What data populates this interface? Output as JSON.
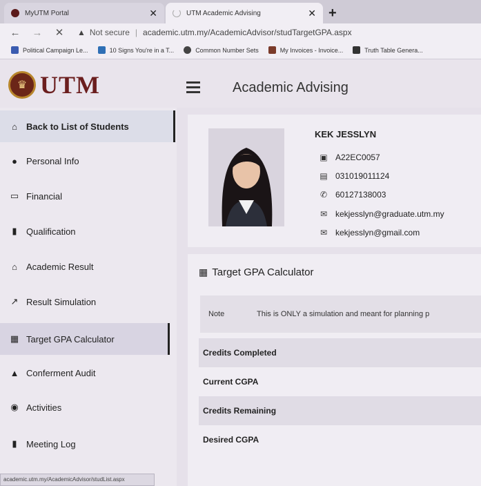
{
  "browser": {
    "tabs": [
      {
        "title": "MyUTM Portal",
        "active": false
      },
      {
        "title": "UTM Academic Advising",
        "active": true
      }
    ],
    "new_tab": "+",
    "security_label": "Not secure",
    "url": "academic.utm.my/AcademicAdvisor/studTargetGPA.aspx",
    "bookmarks": [
      "Political Campaign Le...",
      "10 Signs You're in a T...",
      "Common Number Sets",
      "My Invoices - Invoice...",
      "Truth Table Genera..."
    ],
    "status_url": "academic.utm.my/AcademicAdvisor/studList.aspx"
  },
  "header": {
    "logo_text": "UTM",
    "title": "Academic Advising"
  },
  "sidebar": {
    "items": [
      {
        "label": "Back to List of Students",
        "icon": "home-icon"
      },
      {
        "label": "Personal Info",
        "icon": "user-icon"
      },
      {
        "label": "Financial",
        "icon": "money-icon"
      },
      {
        "label": "Qualification",
        "icon": "book-icon"
      },
      {
        "label": "Academic Result",
        "icon": "bank-icon"
      },
      {
        "label": "Result Simulation",
        "icon": "chart-icon"
      },
      {
        "label": "Target GPA Calculator",
        "icon": "calculator-icon"
      },
      {
        "label": "Conferment Audit",
        "icon": "graduation-cap-icon"
      },
      {
        "label": "Activities",
        "icon": "soccer-ball-icon"
      },
      {
        "label": "Meeting Log",
        "icon": "notebook-icon"
      }
    ]
  },
  "profile": {
    "name": "KEK JESSLYN",
    "matric": "A22EC0057",
    "ic": "031019011124",
    "phone": "60127138003",
    "email_1": "kekjesslyn@graduate.utm.my",
    "email_2": "kekjesslyn@gmail.com"
  },
  "gpa": {
    "title": "Target GPA Calculator",
    "note_label": "Note",
    "note_text": "This is ONLY a simulation and meant for planning p",
    "rows": [
      "Credits Completed",
      "Current CGPA",
      "Credits Remaining",
      "Desired CGPA"
    ]
  }
}
